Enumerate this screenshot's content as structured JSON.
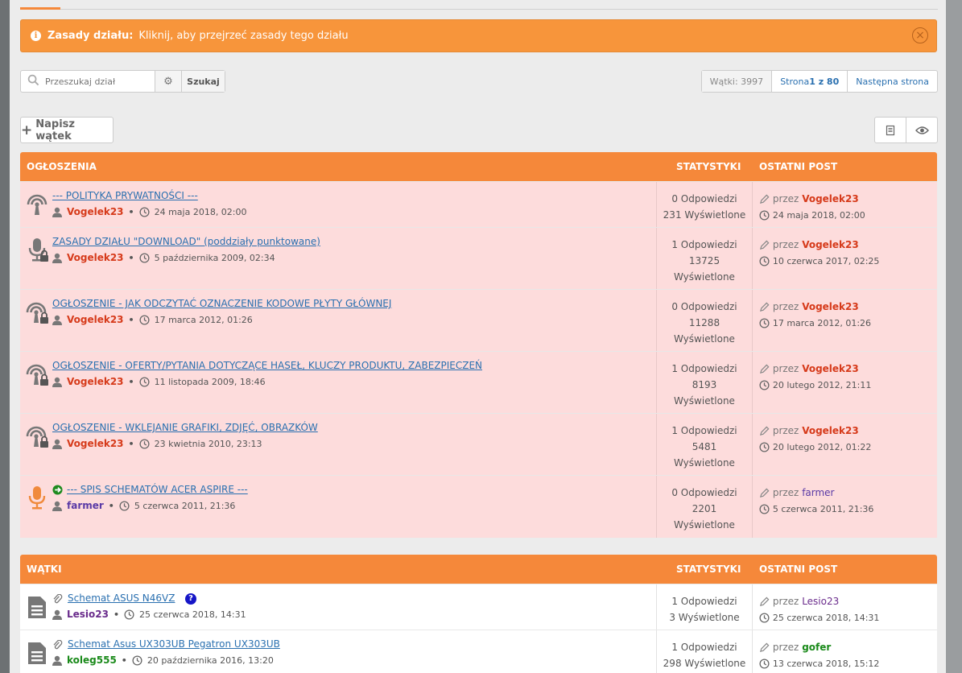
{
  "notice": {
    "title": "Zasady działu:",
    "text": "Kliknij, aby przejrzeć zasady tego działu"
  },
  "search": {
    "placeholder": "Przeszukaj dział",
    "button": "Szukaj"
  },
  "pagination": {
    "count": "Wątki: 3997",
    "page_prefix": "Strona ",
    "page_bold": "1 z 80",
    "next": "Następna strona"
  },
  "new_topic_label": "Napisz wątek",
  "announcements": {
    "header": "OGŁOSZENIA",
    "stats_header": "STATYSTYKI",
    "last_header": "OSTATNI POST",
    "rows": [
      {
        "title": "--- POLITYKA PRYWATNOŚCI ---",
        "author": "Vogelek23",
        "date": "24 maja 2018, 02:00",
        "replies": "0 Odpowiedzi",
        "views": "231 Wyświetlone",
        "views2": "",
        "last_by": "przez",
        "last_author": "Vogelek23",
        "last_date": "24 maja 2018, 02:00"
      },
      {
        "title": "ZASADY DZIAŁU \"DOWNLOAD\" (poddziały punktowane)",
        "author": "Vogelek23",
        "date": "5 października 2009, 02:34",
        "replies": "1 Odpowiedzi",
        "views": "13725",
        "views2": "Wyświetlone",
        "last_by": "przez",
        "last_author": "Vogelek23",
        "last_date": "10 czerwca 2017, 02:25"
      },
      {
        "title": "OGŁOSZENIE - JAK ODCZYTAĆ OZNACZENIE KODOWE PŁYTY GŁÓWNEJ",
        "author": "Vogelek23",
        "date": "17 marca 2012, 01:26",
        "replies": "0 Odpowiedzi",
        "views": "11288",
        "views2": "Wyświetlone",
        "last_by": "przez",
        "last_author": "Vogelek23",
        "last_date": "17 marca 2012, 01:26"
      },
      {
        "title": "OGŁOSZENIE - OFERTY/PYTANIA DOTYCZĄCE HASEŁ, KLUCZY PRODUKTU, ZABEZPIECZEŃ",
        "author": "Vogelek23",
        "date": "11 listopada 2009, 18:46",
        "replies": "1 Odpowiedzi",
        "views": "8193",
        "views2": "Wyświetlone",
        "last_by": "przez",
        "last_author": "Vogelek23",
        "last_date": "20 lutego 2012, 21:11"
      },
      {
        "title": "OGŁOSZENIE - WKLEJANIE GRAFIKI, ZDJĘĆ, OBRAZKÓW",
        "author": "Vogelek23",
        "date": "23 kwietnia 2010, 23:13",
        "replies": "1 Odpowiedzi",
        "views": "5481",
        "views2": "Wyświetlone",
        "last_by": "przez",
        "last_author": "Vogelek23",
        "last_date": "20 lutego 2012, 01:22"
      },
      {
        "title": "--- SPIS SCHEMATÓW ACER ASPIRE ---",
        "author": "farmer",
        "date": "5 czerwca 2011, 21:36",
        "replies": "0 Odpowiedzi",
        "views": "2201",
        "views2": "Wyświetlone",
        "last_by": "przez",
        "last_author": "farmer",
        "last_date": "5 czerwca 2011, 21:36"
      }
    ]
  },
  "topics": {
    "header": "WĄTKI",
    "stats_header": "STATYSTYKI",
    "last_header": "OSTATNI POST",
    "rows": [
      {
        "title": "Schemat ASUS N46VZ",
        "author": "Lesio23",
        "date": "25 czerwca 2018, 14:31",
        "replies": "1 Odpowiedzi",
        "views": "3 Wyświetlone",
        "last_by": "przez",
        "last_author": "Lesio23",
        "last_date": "25 czerwca 2018, 14:31"
      },
      {
        "title": "Schemat Asus UX303UB Pegatron UX303UB",
        "author": "koleg555",
        "date": "20 października 2016, 13:20",
        "replies": "1 Odpowiedzi",
        "views": "298 Wyświetlone",
        "last_by": "przez",
        "last_author": "gofer",
        "last_date": "13 czerwca 2018, 15:12"
      }
    ]
  },
  "colors": {
    "accent": "#f5883a",
    "notice": "#f7953b",
    "sticky_row": "#fddcdc",
    "link": "#2a70b0",
    "admin_red": "#d63a1a"
  }
}
